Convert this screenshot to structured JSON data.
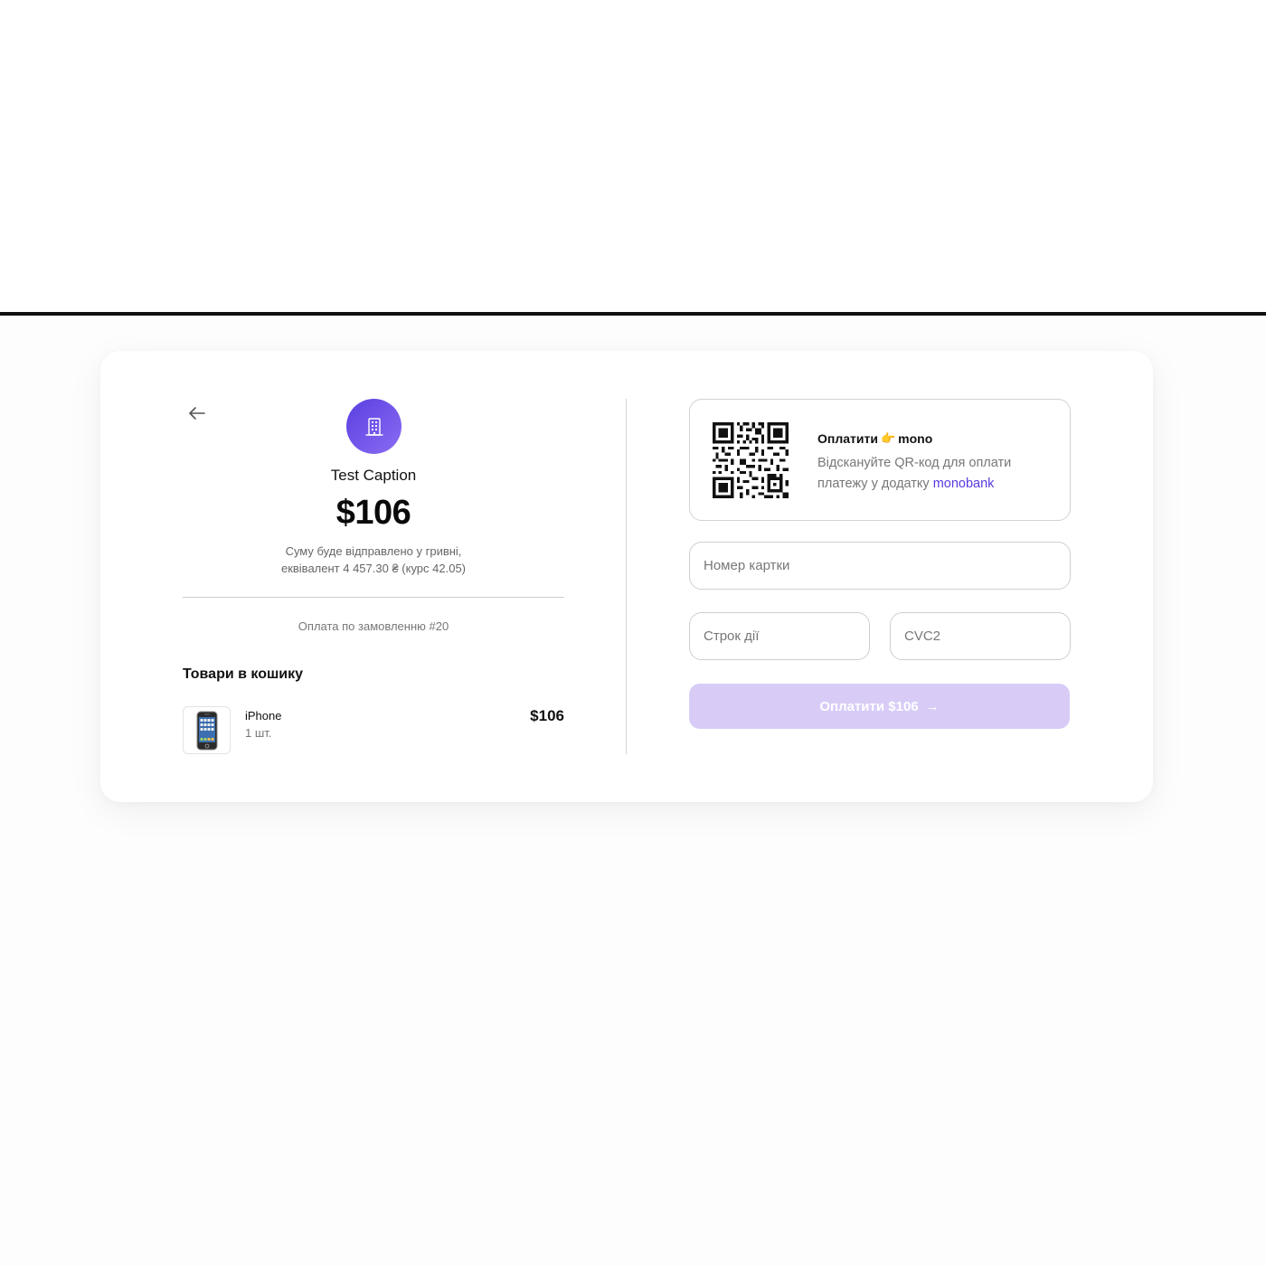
{
  "merchant": {
    "caption": "Test Caption",
    "avatar_icon": "building-icon"
  },
  "payment": {
    "amount": "$106",
    "conversion_note_line1": "Суму буде відправлено у гривні,",
    "conversion_note_line2": "еквівалент 4 457.30 ₴ (курс 42.05)",
    "order_note": "Оплата по замовленню #20"
  },
  "cart": {
    "title": "Товари в кошику",
    "items": [
      {
        "name": "iPhone",
        "quantity": "1 шт.",
        "price": "$106",
        "thumbnail_icon": "iphone-icon"
      }
    ]
  },
  "mono_qr": {
    "title_prefix": "Оплатити",
    "title_brand": "mono",
    "hand_icon": "👉",
    "description": "Відскануйте QR-код для оплати платежу у додатку",
    "app_link": "monobank"
  },
  "form": {
    "card_number_placeholder": "Номер картки",
    "expiry_placeholder": "Строк дії",
    "cvc_placeholder": "CVC2",
    "pay_button_label": "Оплатити $106",
    "pay_button_arrow": "→"
  },
  "colors": {
    "accent": "#5a38e0",
    "pay_button_disabled": "#d8ccf7",
    "avatar_gradient_start": "#5b3fe0",
    "avatar_gradient_end": "#8a6cf3"
  }
}
